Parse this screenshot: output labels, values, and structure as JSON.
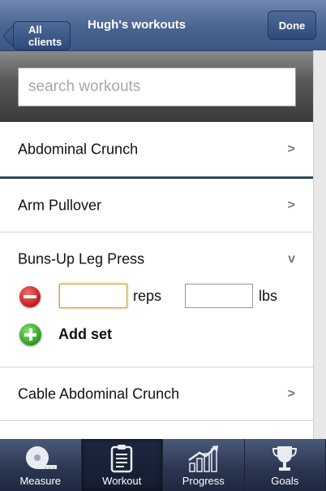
{
  "navbar": {
    "back_label": "All clients",
    "title": "Hugh's workouts",
    "done_label": "Done"
  },
  "search": {
    "placeholder": "search workouts",
    "value": ""
  },
  "workouts": [
    {
      "name": "Abdominal Crunch",
      "indicator": ">"
    },
    {
      "name": "Arm Pullover",
      "indicator": ">"
    },
    {
      "name": "Buns-Up Leg Press",
      "indicator": "v"
    },
    {
      "name": "Cable Abdominal Crunch",
      "indicator": ">"
    }
  ],
  "set_entry": {
    "reps_value": "",
    "reps_label": "reps",
    "lbs_value": "",
    "lbs_label": "lbs",
    "add_set_label": "Add set"
  },
  "tabs": [
    {
      "label": "Measure",
      "icon": "tape-measure-icon"
    },
    {
      "label": "Workout",
      "icon": "clipboard-icon",
      "active": true
    },
    {
      "label": "Progress",
      "icon": "chart-arrow-icon"
    },
    {
      "label": "Goals",
      "icon": "trophy-icon"
    }
  ],
  "colors": {
    "navbar": "#4a6491",
    "tabbar": "#2a3550",
    "separator_accent": "#2b4a5a",
    "remove": "#c81818",
    "add": "#2c9a20"
  }
}
